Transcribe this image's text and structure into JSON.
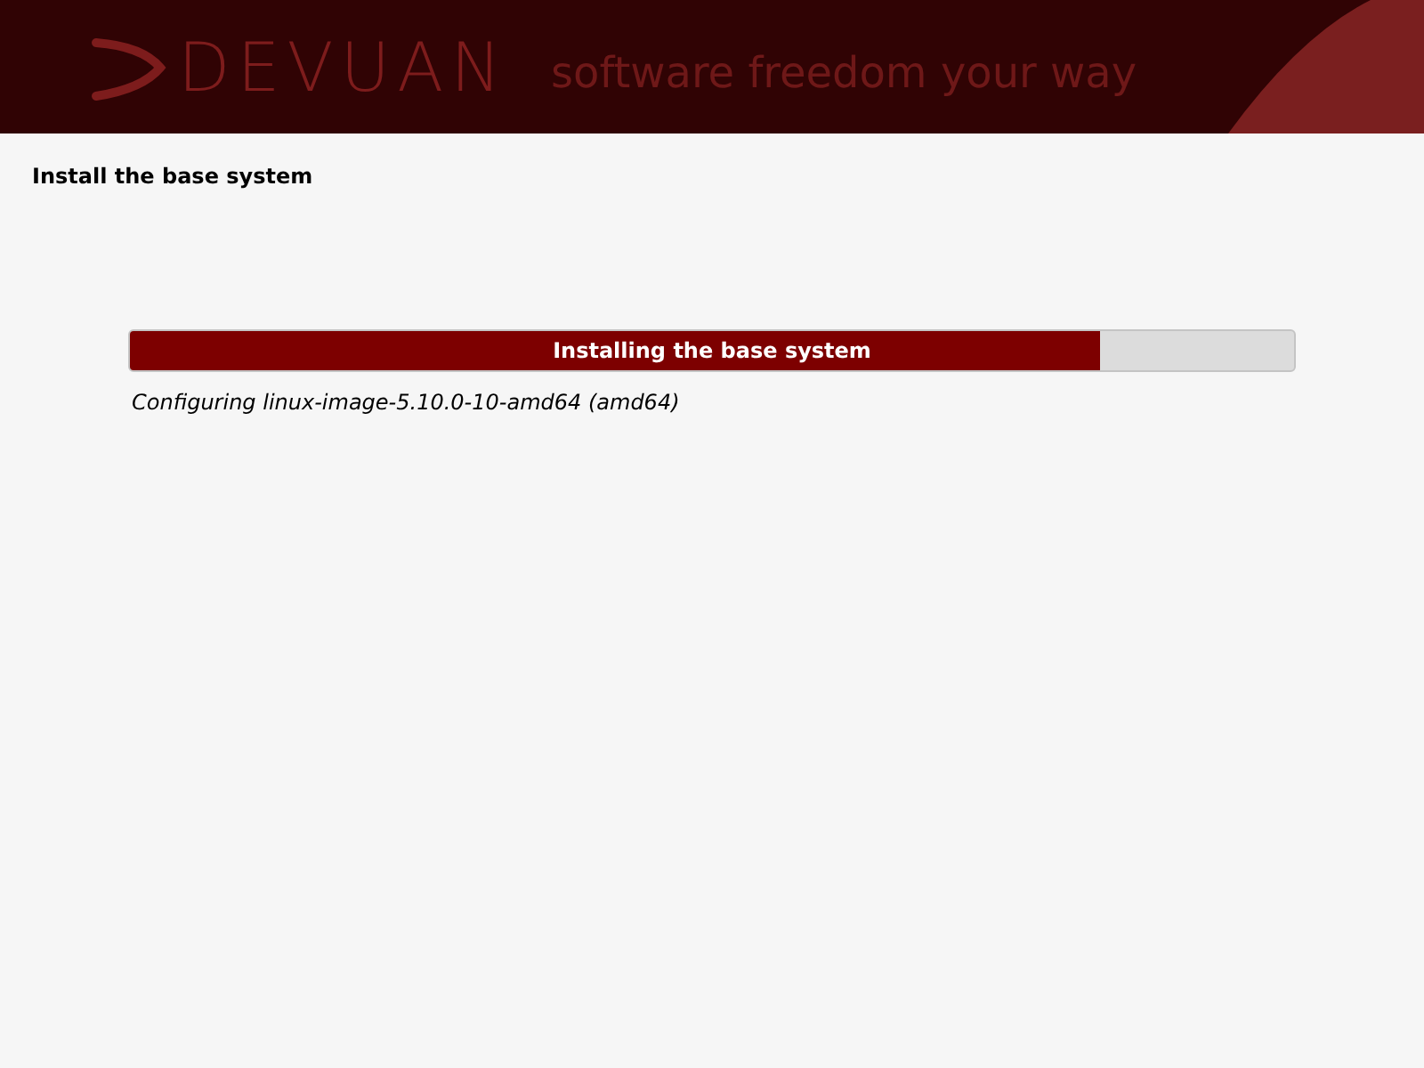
{
  "header": {
    "logo": "DEVUAN",
    "tagline": "software freedom your way"
  },
  "step_title": "Install the base system",
  "progress": {
    "label": "Installing the base system",
    "level": 0.833,
    "status": "Configuring linux-image-5.10.0-10-amd64 (amd64)"
  }
}
